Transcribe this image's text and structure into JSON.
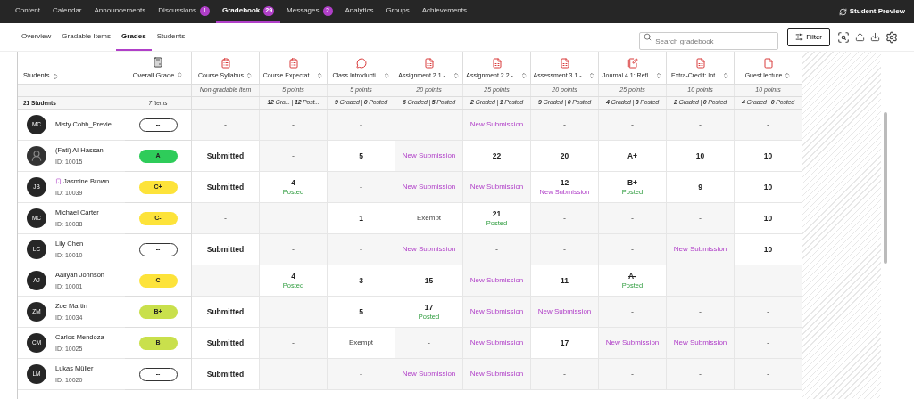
{
  "top_nav": {
    "items": [
      {
        "label": "Content",
        "selected": false
      },
      {
        "label": "Calendar",
        "selected": false
      },
      {
        "label": "Announcements",
        "selected": false
      },
      {
        "label": "Discussions",
        "badge": "1",
        "selected": false
      },
      {
        "label": "Gradebook",
        "badge": "29",
        "selected": true
      },
      {
        "label": "Messages",
        "badge": "2",
        "selected": false
      },
      {
        "label": "Analytics",
        "selected": false
      },
      {
        "label": "Groups",
        "selected": false
      },
      {
        "label": "Achievements",
        "selected": false
      }
    ],
    "student_preview": "Student Preview"
  },
  "sub_nav": {
    "tabs": [
      {
        "label": "Overview",
        "selected": false
      },
      {
        "label": "Gradable Items",
        "selected": false
      },
      {
        "label": "Grades",
        "selected": true
      },
      {
        "label": "Students",
        "selected": false
      }
    ],
    "search": {
      "placeholder": "Search gradebook"
    },
    "filter": "Filter"
  },
  "table": {
    "students_header": "Students",
    "students_count": "21 Students",
    "overall_header": "Overall Grade",
    "overall_count": "7 items",
    "columns": [
      {
        "kind": "clipboard",
        "title": "Course Syllabus",
        "points": "Non-gradable item"
      },
      {
        "kind": "clipboard",
        "title": "Course Expectat...",
        "points": "5 points",
        "counts": "**12** Gra... | **12** Post..."
      },
      {
        "kind": "discussion",
        "title": "Class Introducti...",
        "points": "5 points",
        "counts": "**9** Graded | **0** Posted"
      },
      {
        "kind": "document",
        "title": "Assignment 2.1 -...",
        "points": "20 points",
        "counts": "**6** Graded | **5** Posted"
      },
      {
        "kind": "document",
        "title": "Assignment 2.2 -...",
        "points": "25 points",
        "counts": "**2** Graded | **1** Posted"
      },
      {
        "kind": "document",
        "title": "Assessment 3.1 -...",
        "points": "20 points",
        "counts": "**9** Graded | **0** Posted"
      },
      {
        "kind": "journal",
        "title": "Journal 4.1: Refl...",
        "points": "25 points",
        "counts": "**4** Graded | **3** Posted"
      },
      {
        "kind": "document",
        "title": "Extra-Credit: Int...",
        "points": "10 points",
        "counts": "**2** Graded | **0** Posted"
      },
      {
        "kind": "file",
        "title": "Guest lecture",
        "points": "10 points",
        "counts": "**4** Graded | **0** Posted"
      }
    ],
    "rows": [
      {
        "name": "Misty Cobb_Previe...",
        "avatar": {
          "kind": "initials",
          "text": "MC"
        },
        "flagged": false,
        "grade": {
          "kind": "empty",
          "text": "--"
        },
        "cells": [
          {
            "kind": "dash",
            "text": "-"
          },
          {
            "kind": "dash",
            "text": "-"
          },
          {
            "kind": "dash",
            "text": "-"
          },
          {
            "kind": "blank"
          },
          {
            "kind": "new",
            "text": "New Submission"
          },
          {
            "kind": "dash",
            "text": "-"
          },
          {
            "kind": "dash",
            "text": "-"
          },
          {
            "kind": "dash",
            "text": "-"
          },
          {
            "kind": "dash",
            "text": "-"
          }
        ]
      },
      {
        "name": "(Fati) Al-Hassan",
        "id": "ID: 10015",
        "avatar": {
          "kind": "photo"
        },
        "flagged": false,
        "grade": {
          "kind": "filled",
          "text": "A",
          "color": "#2ecc5a"
        },
        "cells": [
          {
            "kind": "value",
            "text": "Submitted"
          },
          {
            "kind": "dash",
            "text": "-"
          },
          {
            "kind": "value",
            "text": "5"
          },
          {
            "kind": "new",
            "text": "New Submission"
          },
          {
            "kind": "value",
            "text": "22"
          },
          {
            "kind": "value",
            "text": "20"
          },
          {
            "kind": "value",
            "text": "A+"
          },
          {
            "kind": "value",
            "text": "10"
          },
          {
            "kind": "value",
            "text": "10"
          }
        ]
      },
      {
        "name": "Jasmine Brown",
        "id": "ID: 10039",
        "avatar": {
          "kind": "initials",
          "text": "JB"
        },
        "flagged": true,
        "grade": {
          "kind": "filled",
          "text": "C+",
          "color": "#fde33a"
        },
        "cells": [
          {
            "kind": "value",
            "text": "Submitted"
          },
          {
            "kind": "value",
            "text": "4",
            "note": {
              "kind": "posted",
              "text": "Posted"
            }
          },
          {
            "kind": "dash",
            "text": "-"
          },
          {
            "kind": "new",
            "text": "New Submission"
          },
          {
            "kind": "new",
            "text": "New Submission"
          },
          {
            "kind": "value",
            "text": "12",
            "note": {
              "kind": "new",
              "text": "New Submission"
            }
          },
          {
            "kind": "value",
            "text": "B+",
            "note": {
              "kind": "posted",
              "text": "Posted"
            }
          },
          {
            "kind": "value",
            "text": "9"
          },
          {
            "kind": "value",
            "text": "10"
          }
        ]
      },
      {
        "name": "Michael Carter",
        "id": "ID: 10038",
        "avatar": {
          "kind": "initials",
          "text": "MC"
        },
        "flagged": false,
        "grade": {
          "kind": "filled",
          "text": "C-",
          "color": "#fde33a"
        },
        "cells": [
          {
            "kind": "dash",
            "text": "-"
          },
          {
            "kind": "blank"
          },
          {
            "kind": "value",
            "text": "1"
          },
          {
            "kind": "exempt",
            "text": "Exempt"
          },
          {
            "kind": "value",
            "text": "21",
            "note": {
              "kind": "posted",
              "text": "Posted"
            }
          },
          {
            "kind": "dash",
            "text": "-"
          },
          {
            "kind": "dash",
            "text": "-"
          },
          {
            "kind": "dash",
            "text": "-"
          },
          {
            "kind": "value",
            "text": "10"
          }
        ]
      },
      {
        "name": "Lily Chen",
        "id": "ID: 10010",
        "avatar": {
          "kind": "initials",
          "text": "LC"
        },
        "flagged": false,
        "grade": {
          "kind": "empty",
          "text": "--"
        },
        "cells": [
          {
            "kind": "value",
            "text": "Submitted"
          },
          {
            "kind": "dash",
            "text": "-"
          },
          {
            "kind": "dash",
            "text": "-"
          },
          {
            "kind": "new",
            "text": "New Submission"
          },
          {
            "kind": "dash",
            "text": "-"
          },
          {
            "kind": "dash",
            "text": "-"
          },
          {
            "kind": "dash",
            "text": "-"
          },
          {
            "kind": "new",
            "text": "New Submission"
          },
          {
            "kind": "value",
            "text": "10"
          }
        ]
      },
      {
        "name": "Aaliyah Johnson",
        "id": "ID: 10001",
        "avatar": {
          "kind": "initials",
          "text": "AJ"
        },
        "flagged": false,
        "grade": {
          "kind": "filled",
          "text": "C",
          "color": "#fde33a"
        },
        "cells": [
          {
            "kind": "dash",
            "text": "-"
          },
          {
            "kind": "value",
            "text": "4",
            "note": {
              "kind": "posted",
              "text": "Posted"
            }
          },
          {
            "kind": "value",
            "text": "3"
          },
          {
            "kind": "value",
            "text": "15"
          },
          {
            "kind": "new",
            "text": "New Submission"
          },
          {
            "kind": "value",
            "text": "11"
          },
          {
            "kind": "value",
            "text": "A-",
            "struck": true,
            "note": {
              "kind": "posted",
              "text": "Posted"
            }
          },
          {
            "kind": "dash",
            "text": "-"
          },
          {
            "kind": "dash",
            "text": "-"
          }
        ]
      },
      {
        "name": "Zoe Martin",
        "id": "ID: 10034",
        "avatar": {
          "kind": "initials",
          "text": "ZM"
        },
        "flagged": false,
        "grade": {
          "kind": "filled",
          "text": "B+",
          "color": "#c9e04c"
        },
        "cells": [
          {
            "kind": "value",
            "text": "Submitted"
          },
          {
            "kind": "blank"
          },
          {
            "kind": "value",
            "text": "5"
          },
          {
            "kind": "value",
            "text": "17",
            "note": {
              "kind": "posted",
              "text": "Posted"
            }
          },
          {
            "kind": "new",
            "text": "New Submission"
          },
          {
            "kind": "new",
            "text": "New Submission"
          },
          {
            "kind": "dash",
            "text": "-"
          },
          {
            "kind": "dash",
            "text": "-"
          },
          {
            "kind": "dash",
            "text": "-"
          }
        ]
      },
      {
        "name": "Carlos Mendoza",
        "id": "ID: 10025",
        "avatar": {
          "kind": "initials",
          "text": "CM"
        },
        "flagged": false,
        "grade": {
          "kind": "filled",
          "text": "B",
          "color": "#c9e04c"
        },
        "cells": [
          {
            "kind": "value",
            "text": "Submitted"
          },
          {
            "kind": "dash",
            "text": "-"
          },
          {
            "kind": "exempt",
            "text": "Exempt"
          },
          {
            "kind": "dash",
            "text": "-"
          },
          {
            "kind": "new",
            "text": "New Submission"
          },
          {
            "kind": "value",
            "text": "17"
          },
          {
            "kind": "new",
            "text": "New Submission"
          },
          {
            "kind": "new",
            "text": "New Submission"
          },
          {
            "kind": "dash",
            "text": "-"
          }
        ]
      },
      {
        "name": "Lukas Müller",
        "id": "ID: 10020",
        "avatar": {
          "kind": "initials",
          "text": "LM"
        },
        "flagged": false,
        "grade": {
          "kind": "empty",
          "text": "--"
        },
        "cells": [
          {
            "kind": "value",
            "text": "Submitted"
          },
          {
            "kind": "blank"
          },
          {
            "kind": "dash",
            "text": "-"
          },
          {
            "kind": "new",
            "text": "New Submission"
          },
          {
            "kind": "new",
            "text": "New Submission"
          },
          {
            "kind": "dash",
            "text": "-"
          },
          {
            "kind": "dash",
            "text": "-"
          },
          {
            "kind": "dash",
            "text": "-"
          },
          {
            "kind": "dash",
            "text": "-"
          }
        ]
      }
    ]
  }
}
